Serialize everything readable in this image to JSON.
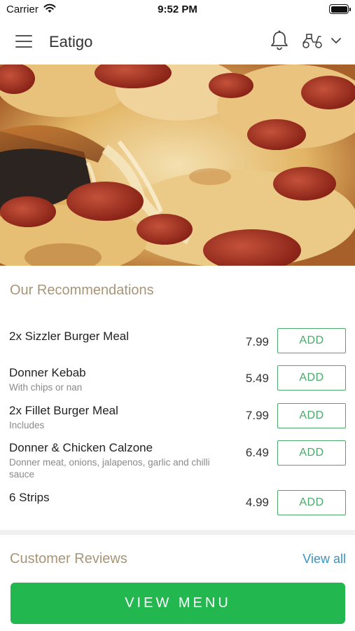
{
  "status_bar": {
    "carrier": "Carrier",
    "time": "9:52 PM"
  },
  "header": {
    "title": "Eatigo",
    "icons": [
      "menu-icon",
      "bell-icon",
      "scooter-icon",
      "chevron-down-icon"
    ]
  },
  "hero": {
    "image": "pizza-photo"
  },
  "recommendations": {
    "title": "Our Recommendations",
    "items": [
      {
        "name": "2x Sizzler Burger Meal",
        "desc": "",
        "price": "7.99",
        "action": "ADD"
      },
      {
        "name": "Donner Kebab",
        "desc": "With chips or nan",
        "price": "5.49",
        "action": "ADD"
      },
      {
        "name": "2x Fillet Burger Meal",
        "desc": "Includes",
        "price": "7.99",
        "action": "ADD"
      },
      {
        "name": "Donner & Chicken Calzone",
        "desc": "Donner meat, onions, jalapenos, garlic and chilli sauce",
        "price": "6.49",
        "action": "ADD"
      },
      {
        "name": "6 Strips",
        "desc": "",
        "price": "4.99",
        "action": "ADD"
      }
    ]
  },
  "reviews": {
    "title": "Customer Reviews",
    "view_all": "View all"
  },
  "footer": {
    "view_menu": "VIEW MENU"
  },
  "colors": {
    "accent_green": "#22b84f",
    "add_green": "#4aa86a",
    "section_tan": "#a89577",
    "link_blue": "#3a93c6"
  }
}
